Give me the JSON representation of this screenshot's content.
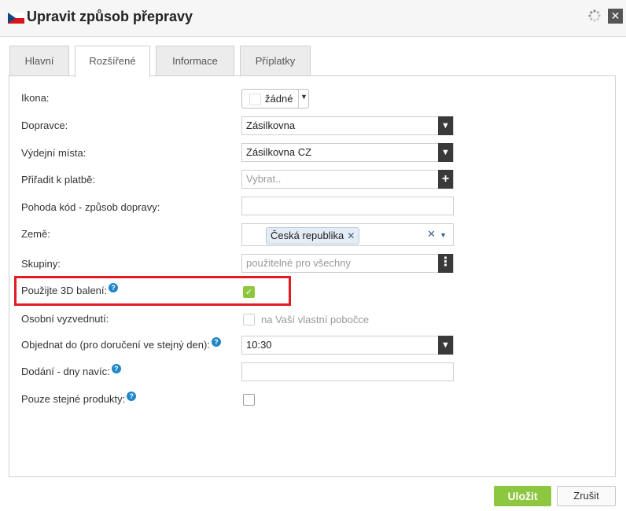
{
  "dialog": {
    "title": "Upravit způsob přepravy"
  },
  "tabs": [
    {
      "label": "Hlavní"
    },
    {
      "label": "Rozšířené",
      "active": true
    },
    {
      "label": "Informace"
    },
    {
      "label": "Příplatky"
    }
  ],
  "form": {
    "ikona": {
      "label": "Ikona:",
      "value": "žádné"
    },
    "dopravce": {
      "label": "Dopravce:",
      "value": "Zásilkovna"
    },
    "vydejni_mista": {
      "label": "Výdejní místa:",
      "value": "Zásilkovna CZ"
    },
    "priradit_k_platbe": {
      "label": "Přiřadit k platbě:",
      "placeholder": "Vybrat.."
    },
    "pohoda_kod": {
      "label": "Pohoda kód - způsob dopravy:",
      "value": ""
    },
    "zeme": {
      "label": "Země:",
      "chips": [
        "Česká republika"
      ]
    },
    "skupiny": {
      "label": "Skupiny:",
      "placeholder": "použitelné pro všechny"
    },
    "pouzijte_3d": {
      "label": "Použijte 3D balení:",
      "checked": true
    },
    "osobni_vyzvednuti": {
      "label": "Osobní vyzvednutí:",
      "option_label": "na Vaší vlastní pobočce",
      "checked": false,
      "disabled": true
    },
    "objednat_do": {
      "label": "Objednat do (pro doručení ve stejný den):",
      "value": "10:30"
    },
    "dodani_dny_navic": {
      "label": "Dodání - dny navíc:",
      "value": ""
    },
    "pouze_stejne": {
      "label": "Pouze stejné produkty:",
      "checked": false
    }
  },
  "buttons": {
    "save": "Uložit",
    "cancel": "Zrušit"
  },
  "colors": {
    "accent_green": "#8dc63f",
    "highlight_red": "#e31b23",
    "help_blue": "#1f86c8"
  }
}
